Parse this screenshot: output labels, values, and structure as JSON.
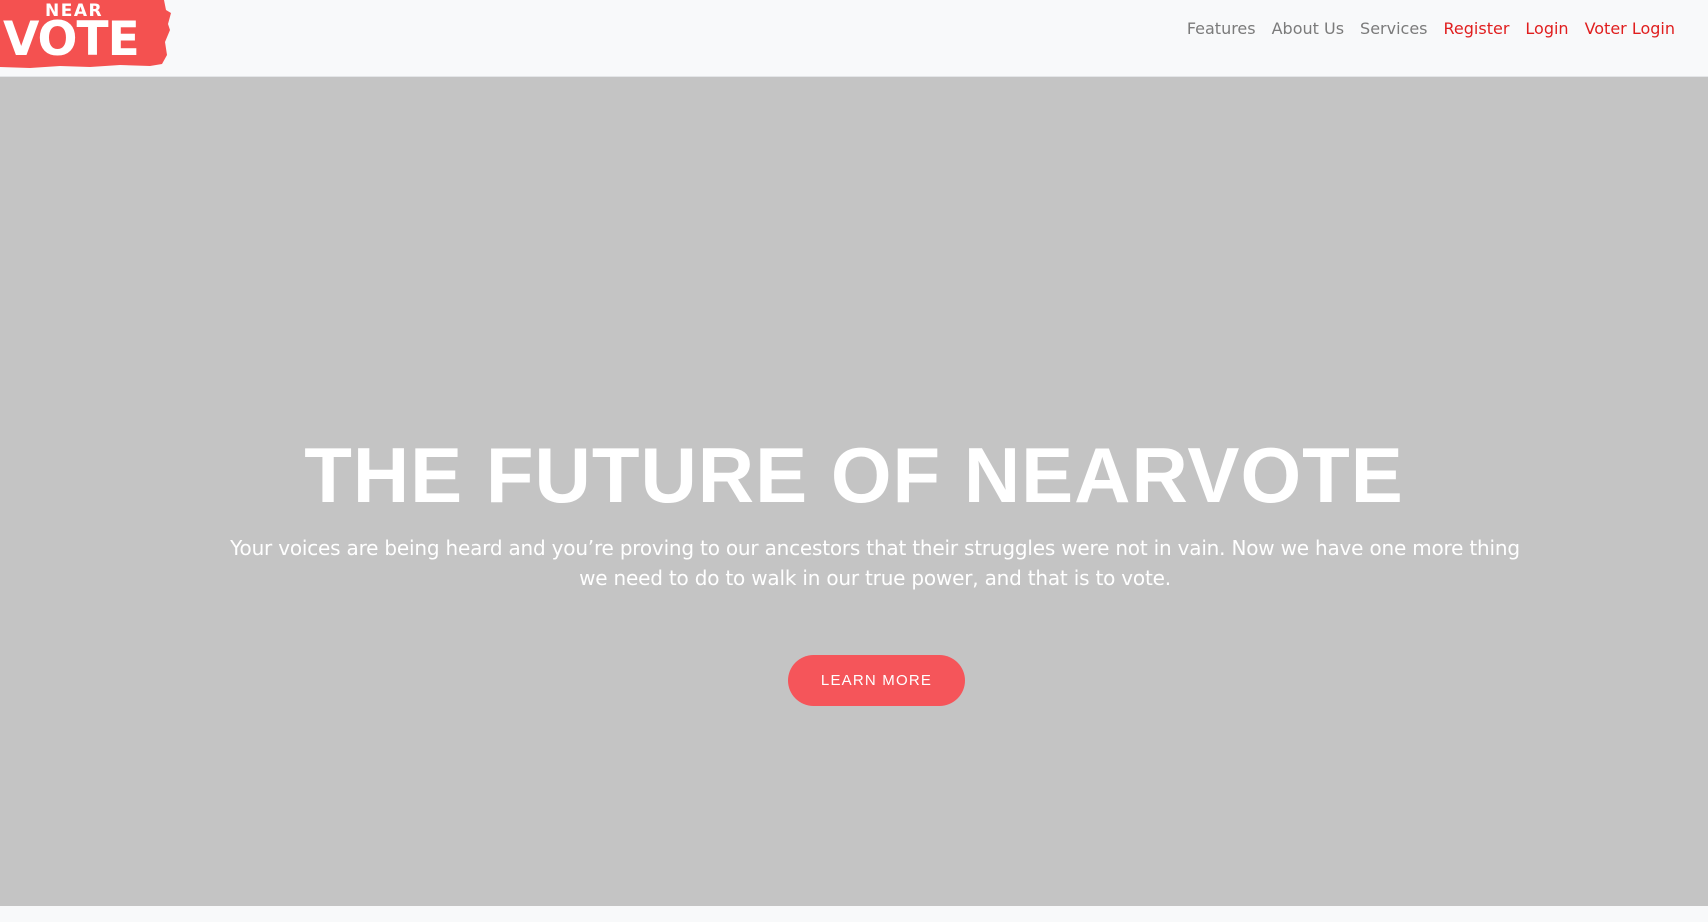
{
  "brand": {
    "logo_top": "NEAR",
    "logo_bottom": "VOTE",
    "color": "#f45150"
  },
  "nav": {
    "items": [
      {
        "label": "Features"
      },
      {
        "label": "About Us"
      },
      {
        "label": "Services"
      },
      {
        "label": "Register"
      },
      {
        "label": "Login"
      },
      {
        "label": "Voter Login"
      }
    ],
    "text_color": "#7b7b7b",
    "accent_color": "#e01e1e"
  },
  "hero": {
    "title": "THE FUTURE OF NEARVOTE",
    "subtitle_line1": "Your voices are being heard and you’re proving to our ancestors that their struggles were not in vain. Now we have one more thing",
    "subtitle_line2": "we need to do to walk in our true power, and that is to vote.",
    "cta_label": "LEARN MORE",
    "background": "#c4c4c4",
    "cta_color": "#f5555a"
  }
}
